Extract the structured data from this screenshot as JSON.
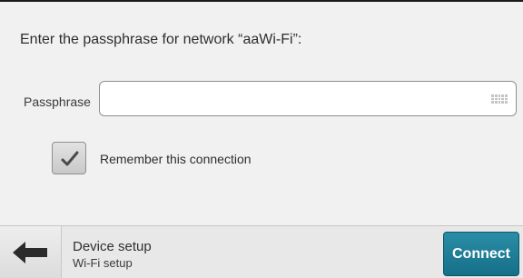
{
  "prompt": {
    "text": "Enter the passphrase for network “aaWi-Fi”:"
  },
  "passphrase": {
    "label": "Passphrase",
    "value": "",
    "placeholder": ""
  },
  "remember": {
    "label": "Remember this connection",
    "checked": true
  },
  "footer": {
    "back_icon": "arrow-left-icon",
    "title": "Device setup",
    "subtitle": "Wi-Fi setup",
    "connect_label": "Connect"
  },
  "colors": {
    "accent": "#1e7e98",
    "background": "#f1f1f1",
    "footer": "#e8e8e8"
  }
}
